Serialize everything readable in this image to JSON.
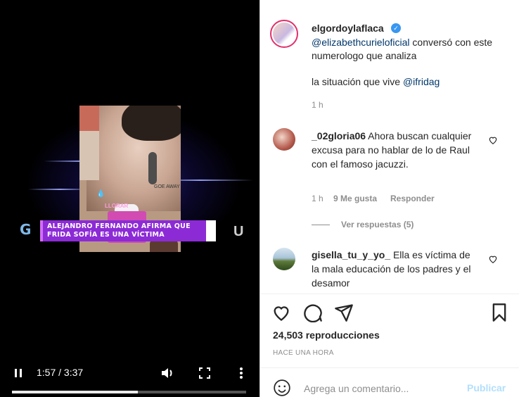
{
  "video": {
    "lower_third_line1": "ALEJANDRO FERNANDO AFIRMA QUE",
    "lower_third_line2": "FRIDA SOFÍA ES UNA VÍCTIMA",
    "tissue_text": "LLORAR",
    "sticker_text": "GOE AWAY",
    "channel_logo": "G",
    "network_logo": "U",
    "time_current": "1:57",
    "time_total": "3:37",
    "time_display": "1:57 / 3:37",
    "progress": 0.539
  },
  "post": {
    "author": "elgordoylaflaca",
    "caption_mention1": "@elizabethcurieloficial",
    "caption_part1": " conversó con este numerologo que analiza",
    "caption_part2": "la situación que vive ",
    "caption_mention2": "@ifridag",
    "time": "1 h"
  },
  "comments": [
    {
      "user": "_02gloria06",
      "text": " Ahora buscan cualquier excusa para no hablar de lo de Raul con el famoso jacuzzi.",
      "time": "1 h",
      "likes": "9 Me gusta",
      "reply": "Responder",
      "view_replies": "Ver respuestas (5)"
    },
    {
      "user": "gisella_tu_y_yo_",
      "text": " Ella es víctima de la mala educación de los padres y el desamor"
    }
  ],
  "stats": {
    "views": "24,503 reproducciones",
    "ago": "HACE UNA HORA"
  },
  "comment_box": {
    "placeholder": "Agrega un comentario...",
    "publish": "Publicar"
  },
  "icons": {
    "play_pause": "pause-icon",
    "volume": "volume-icon",
    "fullscreen": "fullscreen-icon",
    "more": "more-vertical-icon",
    "like": "heart-icon",
    "comment": "comment-icon",
    "share": "share-icon",
    "save": "bookmark-icon",
    "emoji": "emoji-icon",
    "verified": "verified-badge-icon"
  },
  "colors": {
    "accent_link": "#00376b",
    "publish_disabled": "#b2dffc",
    "verified": "#3897f0",
    "lower_third": "#8c2bd6"
  }
}
